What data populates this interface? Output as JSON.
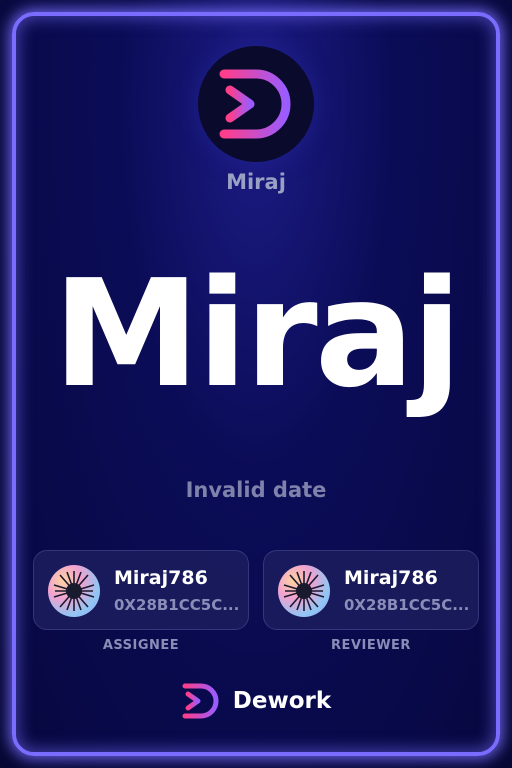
{
  "organization": {
    "name": "Miraj",
    "logo_icon": "dework-logo-icon"
  },
  "task": {
    "title": "Miraj",
    "date": "Invalid date"
  },
  "assignee": {
    "name": "Miraj786",
    "address": "0X28B1CC5C...",
    "role_label": "ASSIGNEE",
    "avatar_icon": "avatar-icon"
  },
  "reviewer": {
    "name": "Miraj786",
    "address": "0X28B1CC5C...",
    "role_label": "REVIEWER",
    "avatar_icon": "avatar-icon"
  },
  "footer": {
    "brand": "Dework",
    "logo_icon": "dework-logo-icon"
  },
  "colors": {
    "background": "#0b0c57",
    "border_glow": "#7a6cff",
    "logo_gradient_start": "#ff3e8a",
    "logo_gradient_end": "#9b5cff"
  }
}
